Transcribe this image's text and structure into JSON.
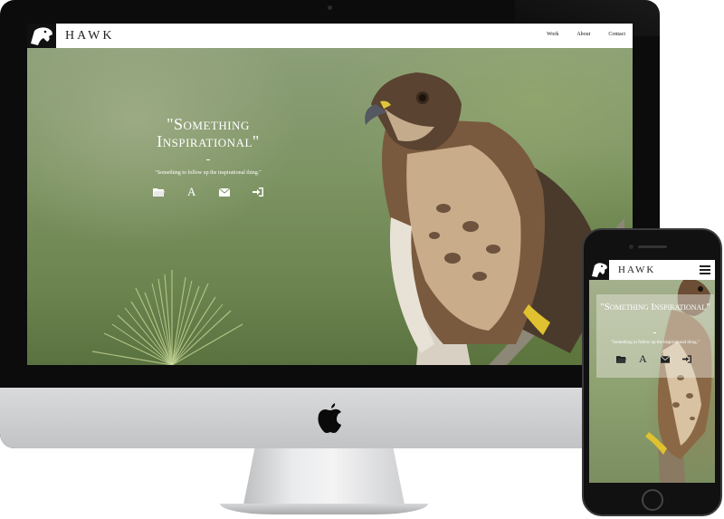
{
  "site": {
    "title": "HAWK",
    "nav": [
      "Work",
      "About",
      "Contact"
    ]
  },
  "hero": {
    "title": "\"Something Inspirational\"",
    "subtitle": "\"Something to follow up the inspirational thing.\"",
    "icons": [
      "folder-icon",
      "font-icon",
      "envelope-icon",
      "sign-in-icon"
    ]
  },
  "mobile": {
    "title": "HAWK",
    "hero_title": "\"Something Inspirational\"",
    "hero_subtitle": "\"Something to follow up the inspirational thing.\""
  },
  "colors": {
    "nav_bg": "#ffffff",
    "hero_text": "#ffffff",
    "device_frame": "#0c0c0d"
  }
}
